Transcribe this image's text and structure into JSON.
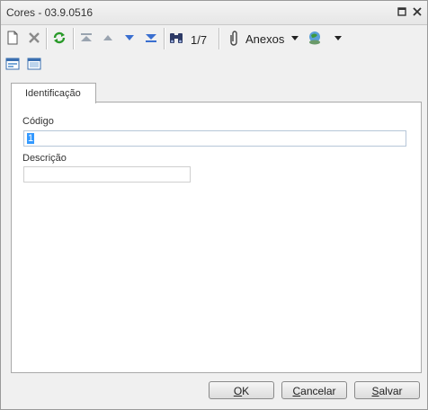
{
  "window": {
    "title": "Cores - 03.9.0516"
  },
  "toolbar": {
    "record_counter": "1/7",
    "attachments_label": "Anexos"
  },
  "tabs": [
    {
      "label": "Identificação"
    }
  ],
  "form": {
    "codigo_label": "Código",
    "codigo_value": "1",
    "descricao_label": "Descrição",
    "descricao_value": ""
  },
  "buttons": {
    "ok_underlined": "O",
    "ok_rest": "K",
    "cancel_underlined": "C",
    "cancel_rest": "ancelar",
    "save_underlined": "S",
    "save_rest": "alvar"
  }
}
